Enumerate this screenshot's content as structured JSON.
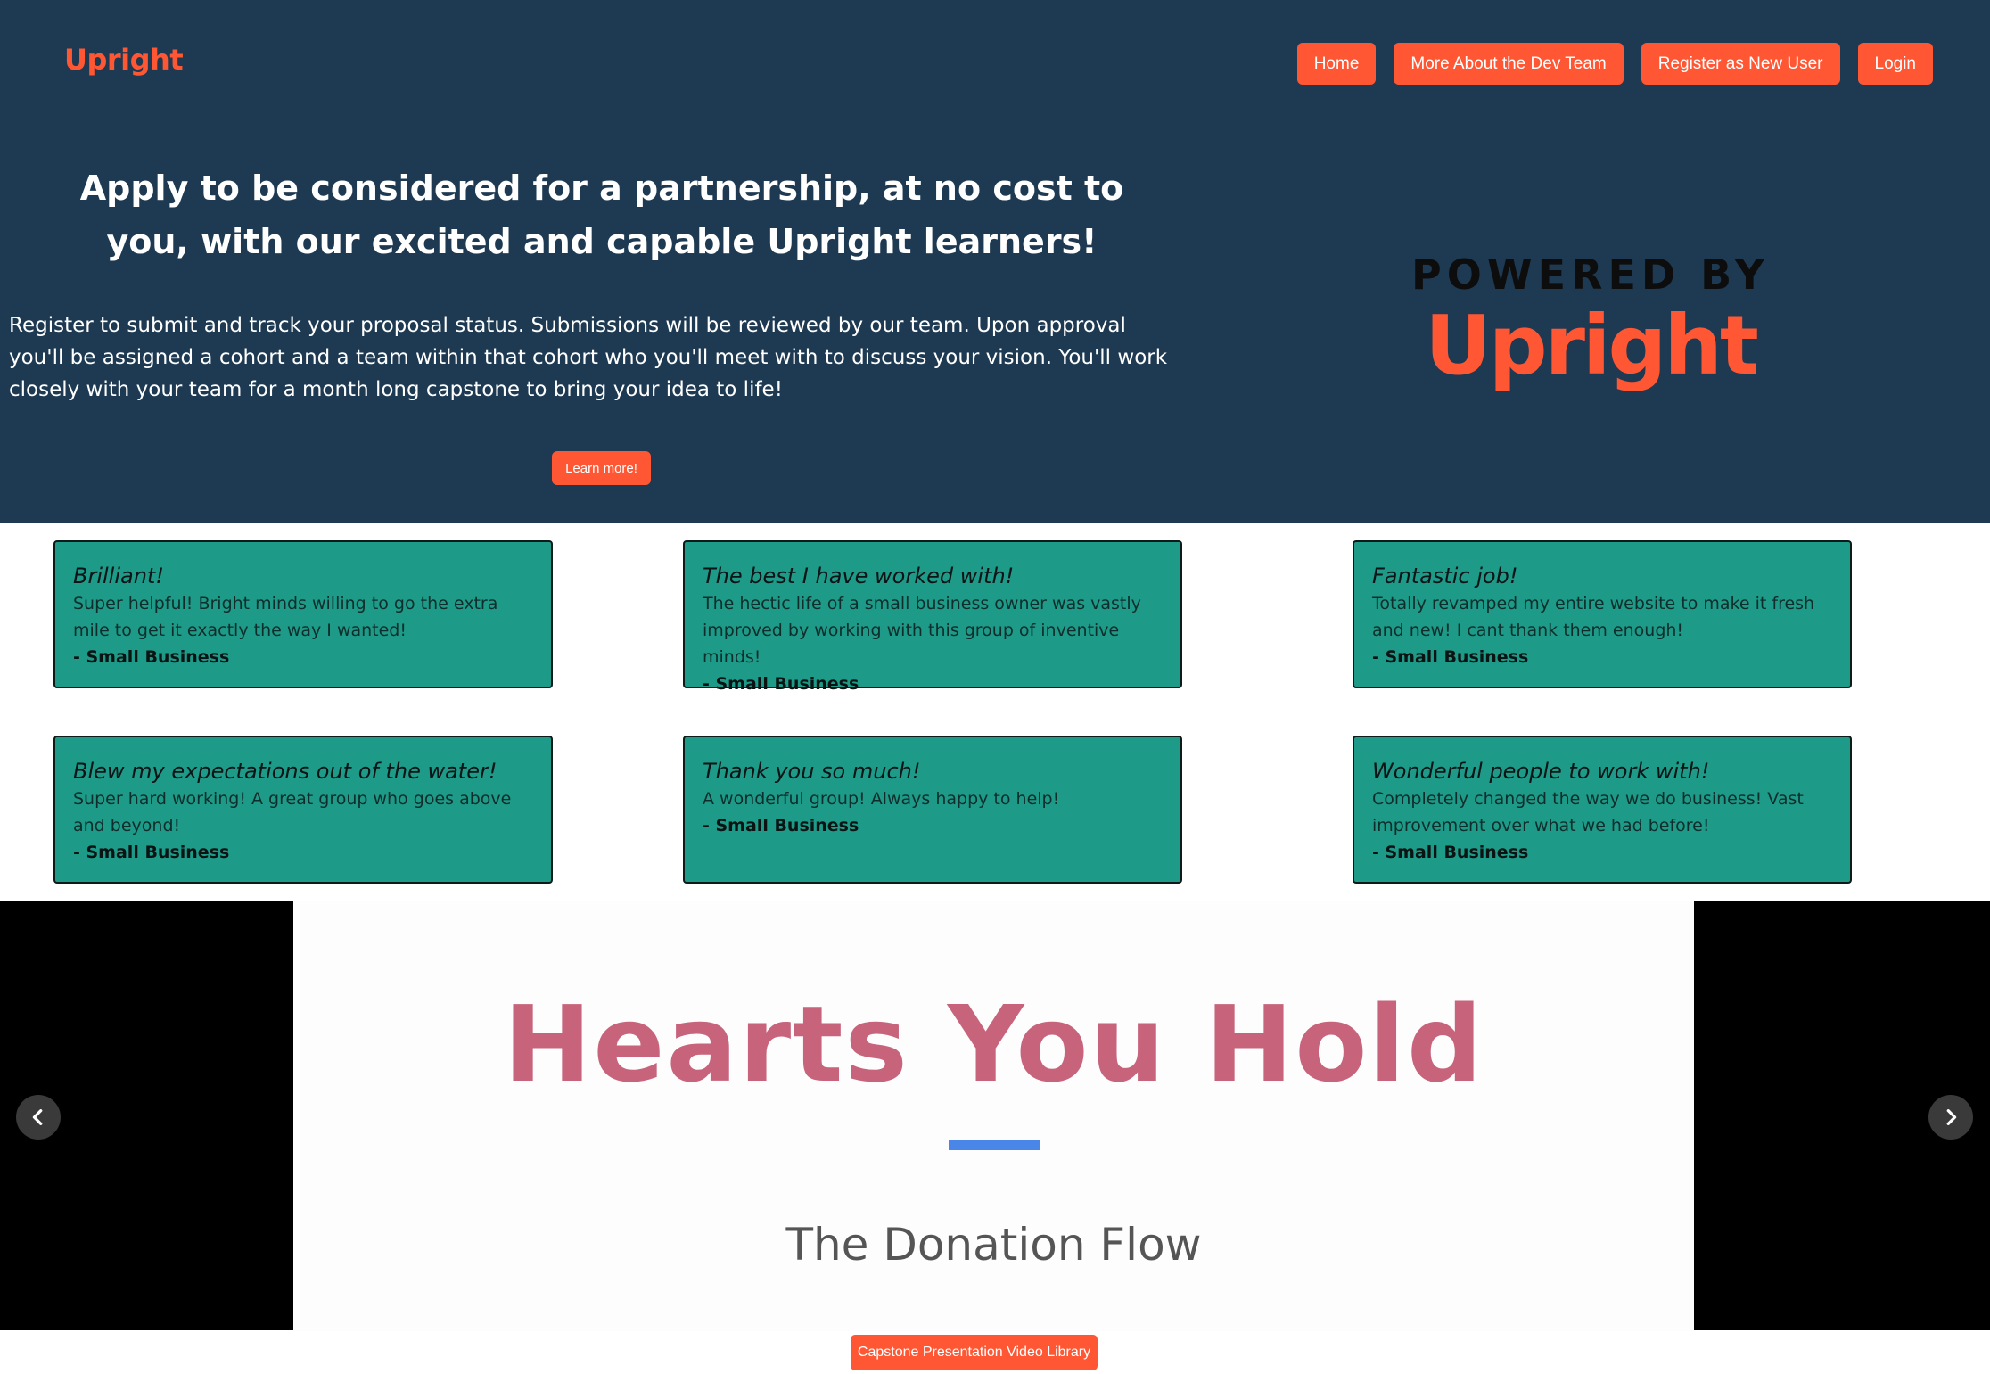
{
  "header": {
    "brand": "Upright",
    "nav": {
      "home": "Home",
      "dev_team": "More About the Dev Team",
      "register": "Register as New User",
      "login": "Login"
    }
  },
  "hero": {
    "headline": "Apply to be considered for a partnership, at no cost to you, with our excited and capable Upright learners!",
    "intro": "Register to submit and track your proposal status. Submissions will be reviewed by our team. Upon approval you'll be assigned a cohort and a team within that cohort who you'll meet with to discuss your vision. You'll work closely with your team for a month long capstone to bring your idea to life!",
    "learn_more": "Learn more!",
    "powered_label": "POWERED BY",
    "powered_brand": "Upright"
  },
  "testimonials": [
    {
      "title": "Brilliant!",
      "body": "Super helpful! Bright minds willing to go the extra mile to get it exactly the way I wanted!",
      "author": "- Small Business"
    },
    {
      "title": "The best I have worked with!",
      "body": "The hectic life of a small business owner was vastly improved by working with this group of inventive minds!",
      "author": "- Small Business"
    },
    {
      "title": "Fantastic job!",
      "body": "Totally revamped my entire website to make it fresh and new! I cant thank them enough!",
      "author": "- Small Business"
    },
    {
      "title": "Blew my expectations out of the water!",
      "body": "Super hard working! A great group who goes above and beyond!",
      "author": "- Small Business"
    },
    {
      "title": "Thank you so much!",
      "body": "A wonderful group! Always happy to help!",
      "author": "- Small Business"
    },
    {
      "title": "Wonderful people to work with!",
      "body": "Completely changed the way we do business! Vast improvement over what we had before!",
      "author": "- Small Business"
    }
  ],
  "carousel": {
    "slide_title": "Hearts You Hold",
    "slide_subtitle": "The Donation Flow",
    "prev_icon": "chevron-left-icon",
    "next_icon": "chevron-right-icon"
  },
  "footer": {
    "library_button": "Capstone Presentation Video Library"
  },
  "colors": {
    "hero_bg": "#1e3a52",
    "accent": "#ff5733",
    "card_bg": "#1e9a88",
    "slide_title": "#c7647c",
    "slide_rule": "#4a86e8"
  }
}
